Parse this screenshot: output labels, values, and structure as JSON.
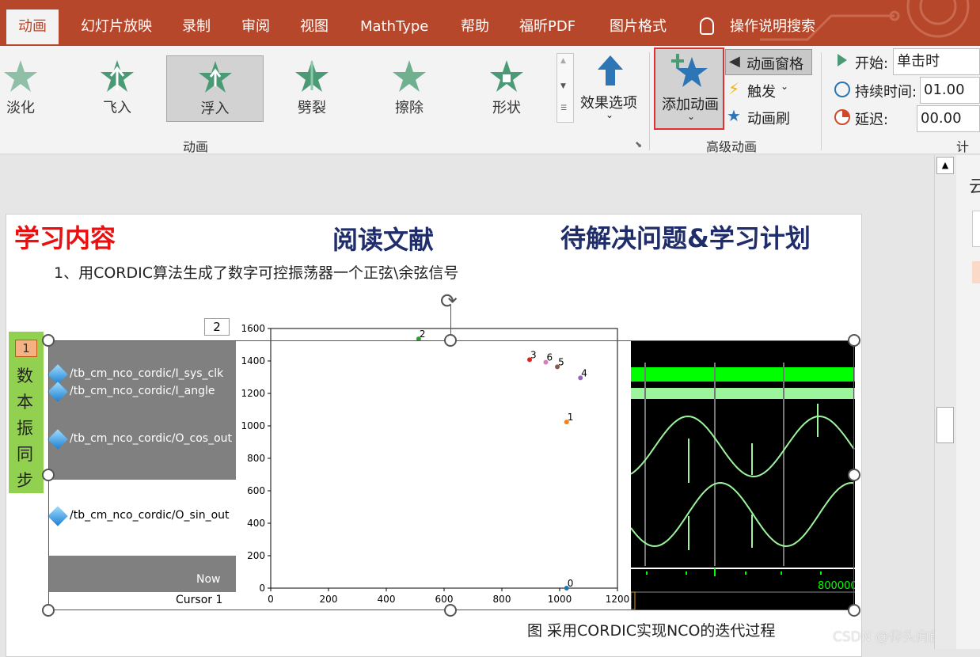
{
  "tabs": [
    "动画",
    "幻灯片放映",
    "录制",
    "审阅",
    "视图",
    "MathType",
    "帮助",
    "福昕PDF",
    "图片格式",
    "操作说明搜索"
  ],
  "ribbon": {
    "gallery": [
      "淡化",
      "飞入",
      "浮入",
      "劈裂",
      "擦除",
      "形状"
    ],
    "effect_options": "效果选项",
    "add_animation": "添加动画",
    "animation_pane": "动画窗格",
    "trigger": "触发",
    "animation_painter": "动画刷",
    "group_animation": "动画",
    "group_advanced": "高级动画",
    "group_timing": "计时",
    "start_label": "开始:",
    "start_value": "单击时",
    "duration_label": "持续时间:",
    "duration_value": "01.00",
    "delay_label": "延迟:",
    "delay_value": "00.00"
  },
  "slide": {
    "h1": "学习内容",
    "h2": "阅读文献",
    "h3": "待解决问题&学习计划",
    "bullet": "1、用CORDIC算法生成了数字可控振荡器一个正弦\\余弦信号",
    "side_text": [
      "数",
      "本",
      "振",
      "同",
      "步"
    ],
    "tag1": "1",
    "tag2": "2",
    "caption": "图 采用CORDIC实现NCO的迭代过程",
    "wave": {
      "signals": [
        "/tb_cm_nco_cordic/I_sys_clk",
        "/tb_cm_nco_cordic/I_angle",
        "/tb_cm_nco_cordic/O_cos_out",
        "/tb_cm_nco_cordic/O_sin_out"
      ],
      "now": "Now",
      "cursor": "Cursor 1",
      "time_label": "800000"
    }
  },
  "watermark": "CSDN @仰头向前走",
  "right_panel_char": "云",
  "chart_data": {
    "type": "scatter",
    "xlim": [
      0,
      1200
    ],
    "ylim": [
      0,
      1600
    ],
    "xticks": [
      0,
      200,
      400,
      600,
      800,
      1000,
      1200
    ],
    "yticks": [
      0,
      200,
      400,
      600,
      800,
      1000,
      1200,
      1400,
      1600
    ],
    "points": [
      {
        "label": "0",
        "x": 1024,
        "y": 0,
        "color": "#1f77b4"
      },
      {
        "label": "1",
        "x": 1024,
        "y": 1024,
        "color": "#ff7f0e"
      },
      {
        "label": "2",
        "x": 512,
        "y": 1536,
        "color": "#2ca02c"
      },
      {
        "label": "3",
        "x": 896,
        "y": 1408,
        "color": "#d62728"
      },
      {
        "label": "4",
        "x": 1072,
        "y": 1296,
        "color": "#9467bd"
      },
      {
        "label": "5",
        "x": 992,
        "y": 1364,
        "color": "#8c564b"
      },
      {
        "label": "6",
        "x": 952,
        "y": 1392,
        "color": "#e377c2"
      }
    ]
  }
}
